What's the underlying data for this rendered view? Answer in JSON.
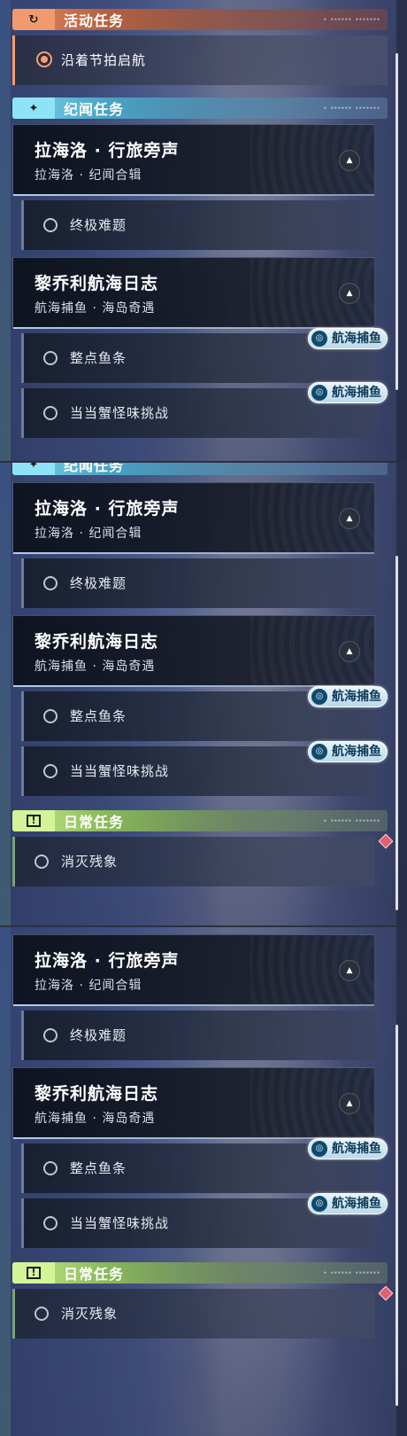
{
  "categories": {
    "event": {
      "title": "活动任务",
      "icon": "refresh-icon",
      "color": "#f09a6e"
    },
    "story": {
      "title": "纪闻任务",
      "icon": "sparkle-icon",
      "color": "#8fe3f7"
    },
    "daily": {
      "title": "日常任务",
      "icon": "alert-icon",
      "color": "#d3f598"
    }
  },
  "event_task": {
    "label": "沿着节拍启航"
  },
  "quests": [
    {
      "title": "拉海洛 · 行旅旁声",
      "subtitle": "拉海洛 · 纪闻合辑",
      "subtasks": [
        {
          "label": "终极难题",
          "tag": null
        }
      ]
    },
    {
      "title": "黎乔利航海日志",
      "subtitle": "航海捕鱼 · 海岛奇遇",
      "subtasks": [
        {
          "label": "整点鱼条",
          "tag": "航海捕鱼"
        },
        {
          "label": "当当蟹怪味挑战",
          "tag": "航海捕鱼"
        }
      ]
    }
  ],
  "daily_task": {
    "label": "消灭残象"
  },
  "tag_label": "航海捕鱼",
  "deco_text": "▪ ▪▪▪▪▪▪ ▪▪▪▪▪▪▪"
}
